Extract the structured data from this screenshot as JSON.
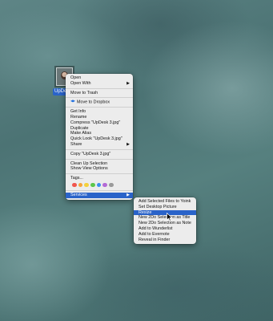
{
  "desktop": {
    "file_icon_label": "UpDe",
    "thumbnail_icon": "photo-thumbnail"
  },
  "context_menu": {
    "items": [
      {
        "label": "Open"
      },
      {
        "label": "Open With",
        "submenu_arrow": "▶"
      },
      {
        "label": "Move to Trash"
      },
      {
        "label": "Move to Dropbox",
        "icon": "dropbox-icon"
      },
      {
        "label": "Get Info"
      },
      {
        "label": "Rename"
      },
      {
        "label": "Compress \"UpDesk 3.jpg\""
      },
      {
        "label": "Duplicate"
      },
      {
        "label": "Make Alias"
      },
      {
        "label": "Quick Look \"UpDesk 3.jpg\""
      },
      {
        "label": "Share",
        "submenu_arrow": "▶"
      },
      {
        "label": "Copy \"UpDesk 3.jpg\""
      },
      {
        "label": "Clean Up Selection"
      },
      {
        "label": "Show View Options"
      },
      {
        "label": "Tags..."
      },
      {
        "label": "Services",
        "submenu_arrow": "▶"
      }
    ],
    "tag_colors": [
      "#f0554d",
      "#f5a43a",
      "#f4d13c",
      "#5cc64b",
      "#3a8ff0",
      "#b36ad6",
      "#9a9a9a"
    ]
  },
  "services_submenu": {
    "items": [
      {
        "label": "Add Selected Files to Yoink"
      },
      {
        "label": "Set Desktop Picture"
      },
      {
        "label": "Resize"
      },
      {
        "label": "New 2Do Selection as Title"
      },
      {
        "label": "New 2Do Selection as Note"
      },
      {
        "label": "Add to Wunderlist"
      },
      {
        "label": "Add to Evernote"
      },
      {
        "label": "Reveal in Finder"
      }
    ]
  },
  "colors": {
    "menu_bg": "#ececec",
    "selection": "#2a63c9"
  }
}
